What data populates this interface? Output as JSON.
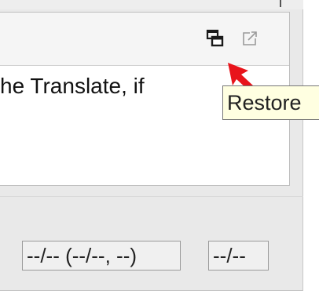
{
  "panel": {
    "toolbar": {
      "restore_icon": "restore-window-icon",
      "popout_icon": "external-link-icon"
    },
    "content_text": "he Translate, if"
  },
  "tooltip": {
    "text": "Restore"
  },
  "status_bar": {
    "date_text": "--/-- (--/--, --)",
    "time_text": "--/--"
  },
  "colors": {
    "arrow": "#e8141b",
    "tooltip_bg": "#ffffe1",
    "icon": "#1a1a1a",
    "icon_disabled": "#9a9a9a"
  }
}
